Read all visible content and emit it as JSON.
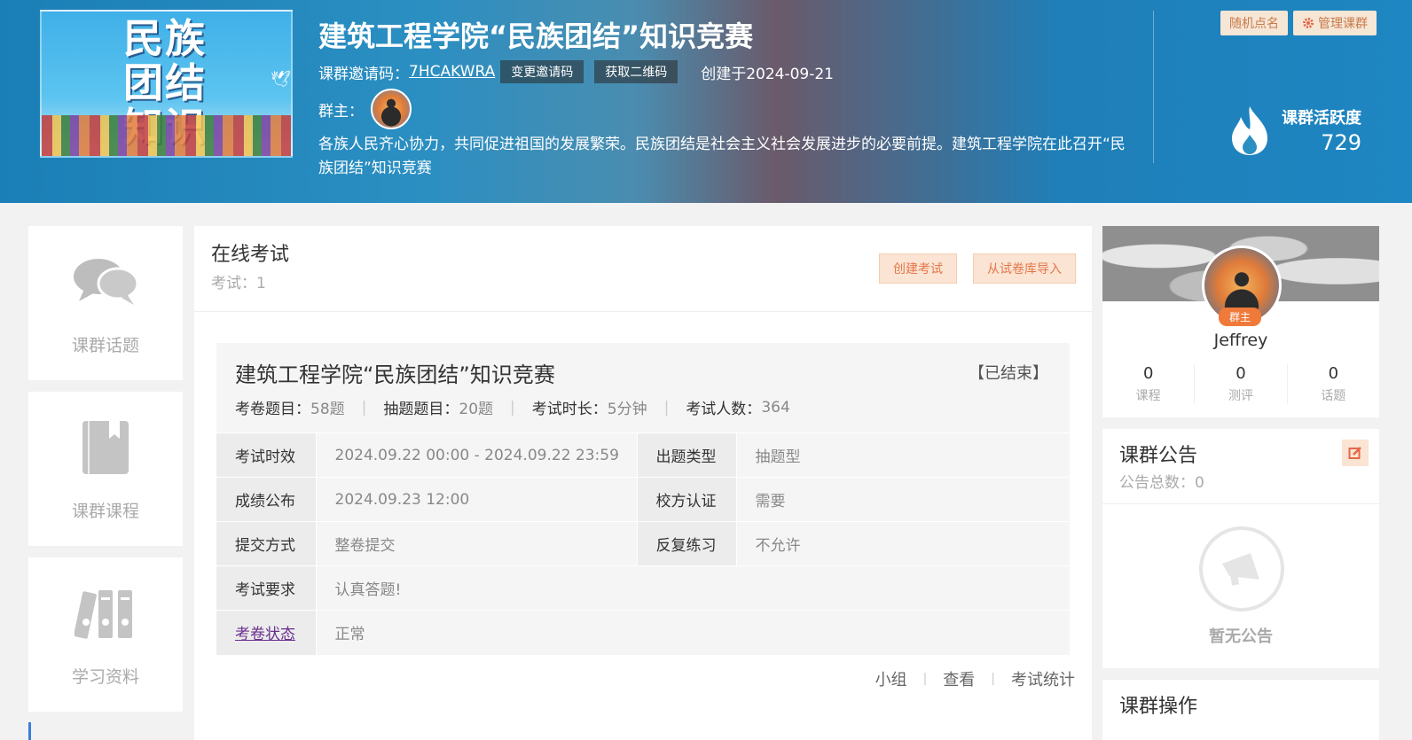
{
  "header": {
    "cover_text": "民族团结知识",
    "title": "建筑工程学院“民族团结”知识竞赛",
    "invite_label": "课群邀请码：",
    "invite_code": "7HCAKWRA",
    "change_code_btn": "变更邀请码",
    "qr_btn": "获取二维码",
    "created": "创建于2024-09-21",
    "owner_label": "群主：",
    "description": "各族人民齐心协力，共同促进祖国的发展繁荣。民族团结是社会主义社会发展进步的必要前提。建筑工程学院在此召开“民族团结”知识竞赛",
    "random_call_btn": "随机点名",
    "manage_btn": "管理课群",
    "activity_label": "课群活跃度",
    "activity_value": "729"
  },
  "nav": [
    {
      "label": "课群话题",
      "icon": "chat-bubbles-icon"
    },
    {
      "label": "课群课程",
      "icon": "book-icon"
    },
    {
      "label": "学习资料",
      "icon": "binders-icon"
    }
  ],
  "main": {
    "title": "在线考试",
    "count_text": "考试：1",
    "create_btn": "创建考试",
    "import_btn": "从试卷库导入",
    "exam": {
      "name": "建筑工程学院“民族团结”知识竞赛",
      "status": "【已结束】",
      "meta": [
        {
          "k": "考卷题目：",
          "v": "58题"
        },
        {
          "k": "抽题题目：",
          "v": "20题"
        },
        {
          "k": "考试时长：",
          "v": "5分钟"
        },
        {
          "k": "考试人数：",
          "v": "364"
        }
      ],
      "rows": {
        "validity_k": "考试时效",
        "validity_v": "2024.09.22 00:00 - 2024.09.22 23:59",
        "qtype_k": "出题类型",
        "qtype_v": "抽题型",
        "publish_k": "成绩公布",
        "publish_v": "2024.09.23 12:00",
        "cert_k": "校方认证",
        "cert_v": "需要",
        "submit_k": "提交方式",
        "submit_v": "整卷提交",
        "repeat_k": "反复练习",
        "repeat_v": "不允许",
        "req_k": "考试要求",
        "req_v": "认真答题!",
        "paper_k": "考卷状态",
        "paper_v": "正常"
      },
      "actions": {
        "group": "小组",
        "view": "查看",
        "stats": "考试统计"
      }
    }
  },
  "profile": {
    "badge": "群主",
    "name": "Jeffrey",
    "stats": [
      {
        "n": "0",
        "l": "课程"
      },
      {
        "n": "0",
        "l": "测评"
      },
      {
        "n": "0",
        "l": "话题"
      }
    ]
  },
  "notice": {
    "title": "课群公告",
    "count": "公告总数：0",
    "empty": "暂无公告"
  },
  "ops": {
    "title": "课群操作"
  },
  "colors": {
    "accent": "#e4774a",
    "banner": "#1e86c2",
    "link": "#6a2f8f"
  }
}
